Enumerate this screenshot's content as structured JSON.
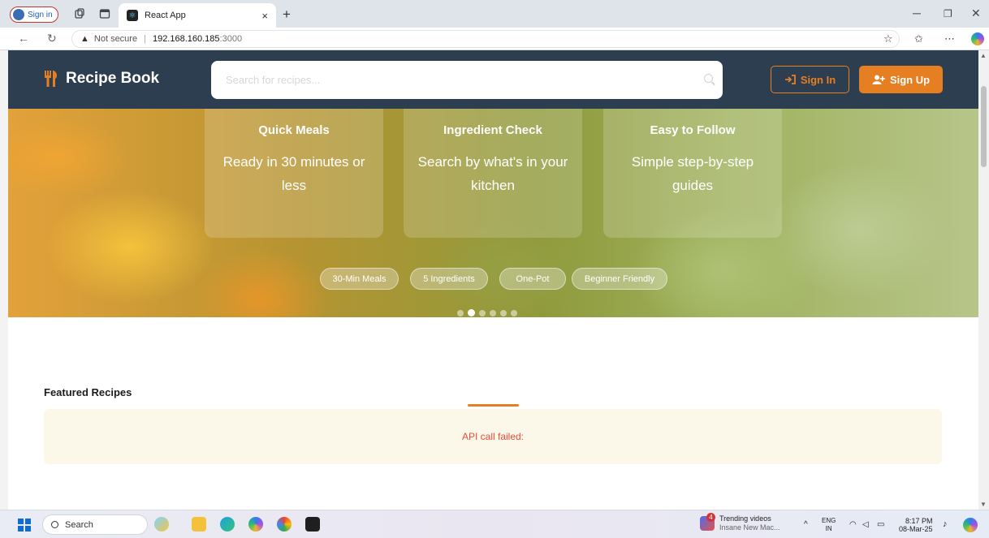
{
  "browser": {
    "profile_label": "Sign in",
    "tab_title": "React App",
    "tab_close": "×",
    "new_tab": "+",
    "url_insecure": "Not secure",
    "url_host": "192.168.160.185",
    "url_port": ":3000"
  },
  "header": {
    "logo_text": "Recipe Book",
    "search_placeholder": "Search for recipes...",
    "signin_label": "Sign In",
    "signup_label": "Sign Up"
  },
  "hero": {
    "cards": [
      {
        "title": "Quick Meals",
        "desc": "Ready in 30 minutes or less"
      },
      {
        "title": "Ingredient Check",
        "desc": "Search by what's in your kitchen"
      },
      {
        "title": "Easy to Follow",
        "desc": "Simple step-by-step guides"
      }
    ],
    "tags": [
      "30-Min Meals",
      "5 Ingredients",
      "One-Pot",
      "Beginner Friendly"
    ],
    "carousel": {
      "total": 6,
      "active_index": 1
    }
  },
  "featured": {
    "title": "Featured Recipes",
    "error_message": "API call failed:"
  },
  "taskbar": {
    "search_label": "Search",
    "news_title": "Trending videos",
    "news_subtitle": "Insane New Mac...",
    "news_badge": "4",
    "lang_line1": "ENG",
    "lang_line2": "IN",
    "time": "8:17 PM",
    "date": "08-Mar-25"
  },
  "colors": {
    "header_bg": "#2c3e50",
    "accent": "#e67e22",
    "error_text": "#e74c3c",
    "error_bg": "#fcf8e9"
  }
}
